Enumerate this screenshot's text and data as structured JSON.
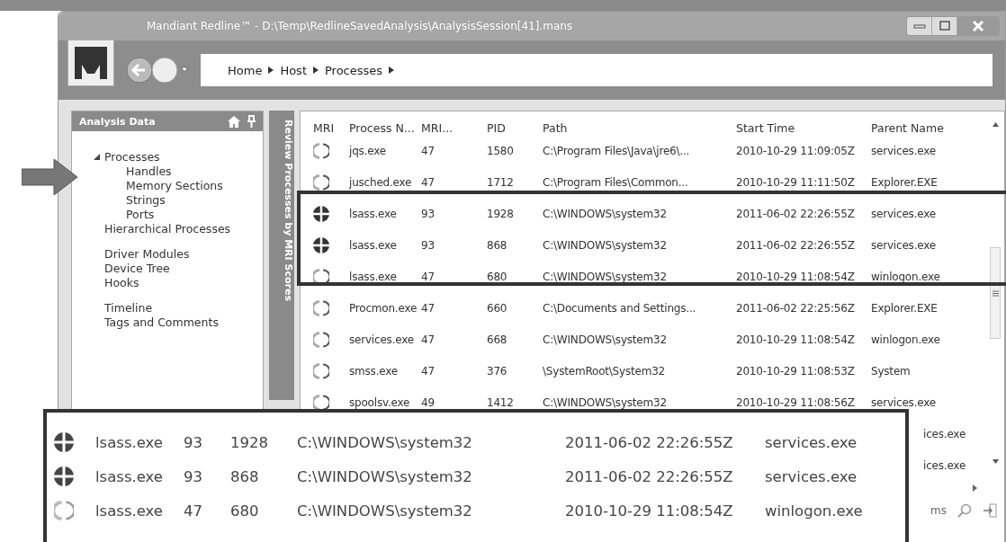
{
  "window": {
    "title": "Mandiant Redline™ - D:\\Temp\\RedlineSavedAnalysis\\AnalysisSession[41].mans"
  },
  "breadcrumb": [
    "Home",
    "Host",
    "Processes"
  ],
  "sidebar": {
    "title": "Analysis Data",
    "groups": [
      [
        {
          "label": "Processes",
          "expanded": true,
          "children": [
            {
              "label": "Handles"
            },
            {
              "label": "Memory Sections"
            },
            {
              "label": "Strings"
            },
            {
              "label": "Ports"
            }
          ]
        },
        {
          "label": "Hierarchical Processes"
        }
      ],
      [
        {
          "label": "Driver Modules"
        },
        {
          "label": "Device Tree"
        },
        {
          "label": "Hooks"
        }
      ],
      [
        {
          "label": "Timeline"
        },
        {
          "label": "Tags and Comments"
        }
      ]
    ]
  },
  "side_tab": "Review Processes by MRI Scores",
  "table": {
    "columns": [
      "MRI",
      "Process N...",
      "MRI...",
      "PID",
      "Path",
      "Start Time",
      "Parent Name"
    ],
    "rows": [
      {
        "kind": "low",
        "name": "jqs.exe",
        "score": "47",
        "pid": "1580",
        "path": "C:\\Program Files\\Java\\jre6\\...",
        "start": "2010-10-29 11:09:05Z",
        "parent": "services.exe"
      },
      {
        "kind": "low",
        "name": "jusched.exe",
        "score": "47",
        "pid": "1712",
        "path": "C:\\Program Files\\Common...",
        "start": "2010-10-29 11:11:50Z",
        "parent": "Explorer.EXE"
      },
      {
        "kind": "high",
        "name": "lsass.exe",
        "score": "93",
        "pid": "1928",
        "path": "C:\\WINDOWS\\system32",
        "start": "2011-06-02 22:26:55Z",
        "parent": "services.exe"
      },
      {
        "kind": "high",
        "name": "lsass.exe",
        "score": "93",
        "pid": "868",
        "path": "C:\\WINDOWS\\system32",
        "start": "2011-06-02 22:26:55Z",
        "parent": "services.exe"
      },
      {
        "kind": "low",
        "name": "lsass.exe",
        "score": "47",
        "pid": "680",
        "path": "C:\\WINDOWS\\system32",
        "start": "2010-10-29 11:08:54Z",
        "parent": "winlogon.exe"
      },
      {
        "kind": "low",
        "name": "Procmon.exe",
        "score": "47",
        "pid": "660",
        "path": "C:\\Documents and Settings...",
        "start": "2011-06-02 22:25:56Z",
        "parent": "Explorer.EXE"
      },
      {
        "kind": "low",
        "name": "services.exe",
        "score": "47",
        "pid": "668",
        "path": "C:\\WINDOWS\\system32",
        "start": "2010-10-29 11:08:54Z",
        "parent": "winlogon.exe"
      },
      {
        "kind": "low",
        "name": "smss.exe",
        "score": "47",
        "pid": "376",
        "path": "\\SystemRoot\\System32",
        "start": "2010-10-29 11:08:53Z",
        "parent": "System"
      },
      {
        "kind": "low",
        "name": "spoolsv.exe",
        "score": "49",
        "pid": "1412",
        "path": "C:\\WINDOWS\\system32",
        "start": "2010-10-29 11:08:56Z",
        "parent": "services.exe"
      }
    ],
    "covered_rows": [
      {
        "parent": "ices.exe"
      },
      {
        "parent": "ices.exe"
      }
    ],
    "footer_text": "ms"
  },
  "inset": {
    "rows": [
      {
        "kind": "high",
        "name": "lsass.exe",
        "score": "93",
        "pid": "1928",
        "path": "C:\\WINDOWS\\system32",
        "start": "2011-06-02 22:26:55Z",
        "parent": "services.exe"
      },
      {
        "kind": "high",
        "name": "lsass.exe",
        "score": "93",
        "pid": "868",
        "path": "C:\\WINDOWS\\system32",
        "start": "2011-06-02 22:26:55Z",
        "parent": "services.exe"
      },
      {
        "kind": "low",
        "name": "lsass.exe",
        "score": "47",
        "pid": "680",
        "path": "C:\\WINDOWS\\system32",
        "start": "2010-10-29 11:08:54Z",
        "parent": "winlogon.exe"
      }
    ]
  }
}
